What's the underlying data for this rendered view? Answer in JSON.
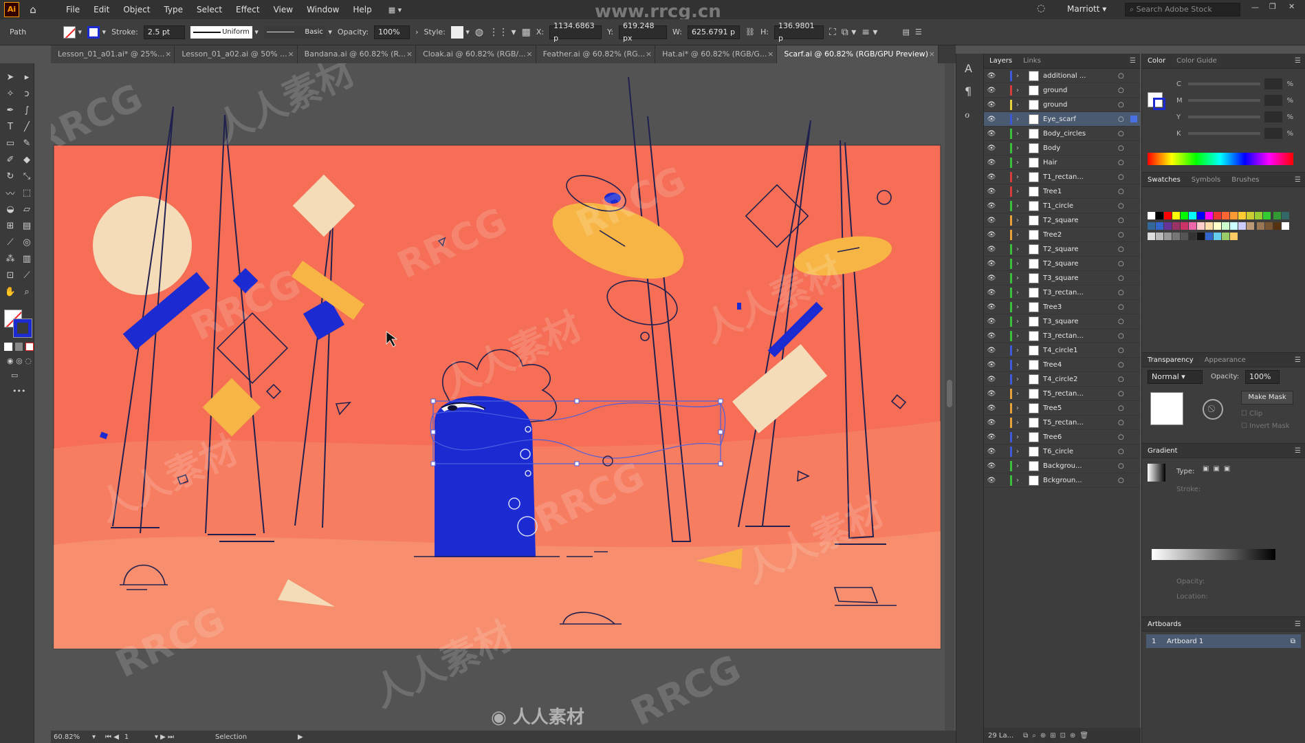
{
  "menu": [
    "File",
    "Edit",
    "Object",
    "Type",
    "Select",
    "Effect",
    "View",
    "Window",
    "Help"
  ],
  "app_logo": "Ai",
  "top_right": {
    "user": "Marriott",
    "search_placeholder": "Search Adobe Stock"
  },
  "control": {
    "selection_type": "Path",
    "stroke_label": "Stroke:",
    "stroke_value": "2.5 pt",
    "profile": "Uniform",
    "brush": "Basic",
    "opacity_label": "Opacity:",
    "opacity_value": "100%",
    "style_label": "Style:",
    "x_label": "X:",
    "x_value": "1134.6863 p",
    "y_label": "Y:",
    "y_value": "619.248 px",
    "w_label": "W:",
    "w_value": "625.6791 p",
    "h_label": "H:",
    "h_value": "136.9801 p"
  },
  "tabs": [
    {
      "label": "Lesson_01_a01.ai* @ 25%..."
    },
    {
      "label": "Lesson_01_a02.ai @ 50% ..."
    },
    {
      "label": "Bandana.ai @ 60.82% (R..."
    },
    {
      "label": "Cloak.ai @ 60.82% (RGB/..."
    },
    {
      "label": "Feather.ai @ 60.82% (RG..."
    },
    {
      "label": "Hat.ai* @ 60.82% (RGB/G..."
    },
    {
      "label": "Scarf.ai @ 60.82% (RGB/GPU Preview)",
      "active": true
    }
  ],
  "watermark_text": "www.rrcg.cn",
  "layers_panel": {
    "tabs": [
      "Layers",
      "Links"
    ],
    "rows": [
      {
        "name": "additional ...",
        "color": "#3d5bd9"
      },
      {
        "name": "ground",
        "color": "#d63c3c"
      },
      {
        "name": "ground",
        "color": "#e8d23c"
      },
      {
        "name": "Eye_scarf",
        "color": "#3d5bd9",
        "selected": true
      },
      {
        "name": "Body_circles",
        "color": "#3cbf3c"
      },
      {
        "name": "Body",
        "color": "#3cbf3c"
      },
      {
        "name": "Hair",
        "color": "#3cbf3c"
      },
      {
        "name": "T1_rectan...",
        "color": "#d63c3c"
      },
      {
        "name": "Tree1",
        "color": "#d63c3c"
      },
      {
        "name": "T1_circle",
        "color": "#3cbf3c"
      },
      {
        "name": "T2_square",
        "color": "#e8a23c"
      },
      {
        "name": "Tree2",
        "color": "#e8a23c"
      },
      {
        "name": "T2_square",
        "color": "#3cbf3c"
      },
      {
        "name": "T2_square",
        "color": "#3cbf3c"
      },
      {
        "name": "T3_square",
        "color": "#3cbf3c"
      },
      {
        "name": "T3_rectan...",
        "color": "#3cbf3c"
      },
      {
        "name": "Tree3",
        "color": "#3cbf3c"
      },
      {
        "name": "T3_square",
        "color": "#3cbf3c"
      },
      {
        "name": "T3_rectan...",
        "color": "#3cbf3c"
      },
      {
        "name": "T4_circle1",
        "color": "#3d5bd9"
      },
      {
        "name": "Tree4",
        "color": "#3d5bd9"
      },
      {
        "name": "T4_circle2",
        "color": "#3d5bd9"
      },
      {
        "name": "T5_rectan...",
        "color": "#e8a23c"
      },
      {
        "name": "Tree5",
        "color": "#e8a23c"
      },
      {
        "name": "T5_rectan...",
        "color": "#e8a23c"
      },
      {
        "name": "Tree6",
        "color": "#3d5bd9"
      },
      {
        "name": "T6_circle",
        "color": "#3d5bd9"
      },
      {
        "name": "Backgrou...",
        "color": "#3cbf3c"
      },
      {
        "name": "Bckgroun...",
        "color": "#3cbf3c"
      }
    ],
    "footer": "29 La..."
  },
  "color_panel": {
    "tabs": [
      "Color",
      "Color Guide"
    ],
    "channels": [
      "C",
      "M",
      "Y",
      "K"
    ]
  },
  "swatches_panel": {
    "tabs": [
      "Swatches",
      "Symbols",
      "Brushes"
    ]
  },
  "transparency_panel": {
    "tabs": [
      "Transparency",
      "Appearance"
    ],
    "mode": "Normal",
    "opacity_label": "Opacity:",
    "opacity": "100%",
    "make_mask": "Make Mask",
    "clip": "Clip",
    "invert": "Invert Mask"
  },
  "gradient_panel": {
    "title": "Gradient",
    "type_label": "Type:",
    "stroke_label": "Stroke:",
    "opacity_label": "Opacity:",
    "location_label": "Location:"
  },
  "artboards_panel": {
    "title": "Artboards",
    "index": "1",
    "name": "Artboard 1"
  },
  "status": {
    "zoom": "60.82%",
    "artboard": "1",
    "tool": "Selection"
  },
  "colors": {
    "artboard_bg": "#f56e55",
    "accent_blue": "#1b2ad1",
    "yellow": "#f7b545",
    "cream": "#f4dcb8",
    "stroke": "#202050"
  }
}
